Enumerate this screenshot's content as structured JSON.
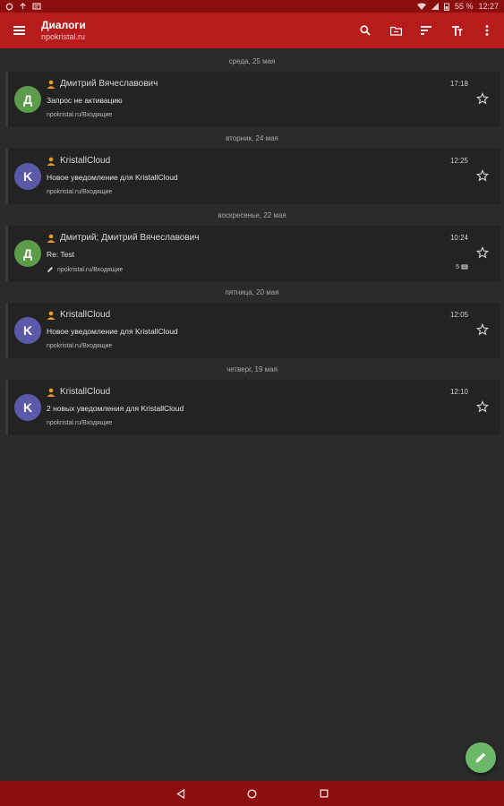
{
  "status_bar": {
    "battery": "55 %",
    "time": "12:27"
  },
  "app_bar": {
    "title": "Диалоги",
    "subtitle": "npokristal.ru"
  },
  "icons": {
    "menu": "menu-icon",
    "search": "search-icon",
    "folder": "folder-icon",
    "sort": "sort-icon",
    "text": "text-format-icon",
    "more": "more-vert-icon"
  },
  "colors": {
    "app_bar": "#b71c1c",
    "status_bar": "#8a0e0e",
    "background": "#2b2b2b",
    "fab": "#6cb86a"
  },
  "groups": [
    {
      "date": "среда, 25 мая",
      "items": [
        {
          "avatar": "Д",
          "sender": "Дмитрий Вячеславович",
          "time": "17:18",
          "subject": "Запрос не активацию",
          "folder": "npokristal.ru/Входящие"
        }
      ]
    },
    {
      "date": "вторник, 24 мая",
      "items": [
        {
          "avatar": "K",
          "sender": "KristallCloud",
          "time": "12:25",
          "subject": "Новое уведомление для KristallCloud",
          "folder": "npokristal.ru/Входящие"
        }
      ]
    },
    {
      "date": "воскресенье, 22 мая",
      "items": [
        {
          "avatar": "Д",
          "sender": "Дмитрий; Дмитрий Вячеславович",
          "time": "10:24",
          "subject": "Re: Test",
          "folder": "npokristal.ru/Входящие",
          "count": "5"
        }
      ]
    },
    {
      "date": "пятница, 20 мая",
      "items": [
        {
          "avatar": "K",
          "sender": "KristallCloud",
          "time": "12:05",
          "subject": "Новое уведомление для KristallCloud",
          "folder": "npokristal.ru/Входящие"
        }
      ]
    },
    {
      "date": "четверг, 19 мая",
      "items": [
        {
          "avatar": "K",
          "sender": "KristallCloud",
          "time": "12:10",
          "subject": "2 новых уведомления для KristallCloud",
          "folder": "npokristal.ru/Входящие"
        }
      ]
    }
  ]
}
